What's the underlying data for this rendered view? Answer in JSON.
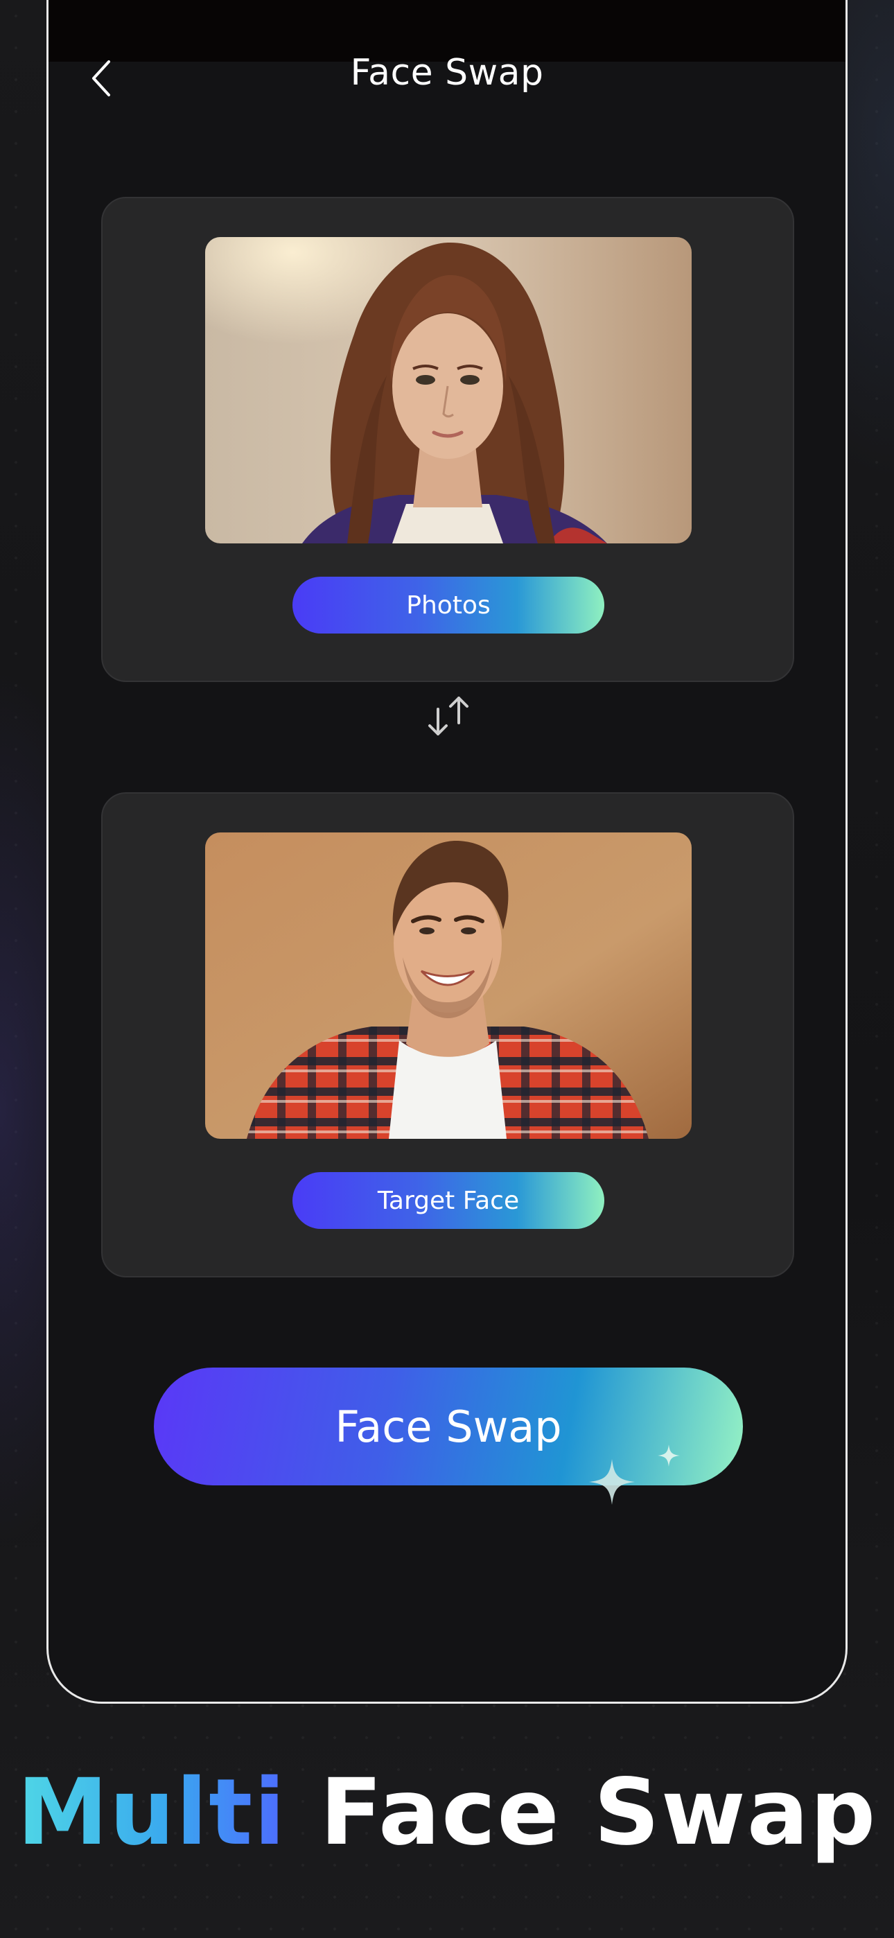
{
  "header": {
    "title": "Face Swap",
    "back_icon": "chevron-left-icon"
  },
  "source_card": {
    "photo_description": "portrait of a woman with long wavy auburn hair and freckles",
    "button_label": "Photos"
  },
  "swap_icon": "swap-vertical-arrows-icon",
  "target_card": {
    "photo_description": "smiling man in red plaid shirt on tan background",
    "button_label": "Target Face"
  },
  "primary_action": {
    "label": "Face Swap"
  },
  "banner": {
    "accent_word": "Multi",
    "rest": "Face Swap"
  },
  "colors": {
    "background": "#161617",
    "card": "#272728",
    "gradient_start": "#4a3cf6",
    "gradient_end": "#8ff0c0",
    "headline_accent": "#3aa9ee"
  }
}
